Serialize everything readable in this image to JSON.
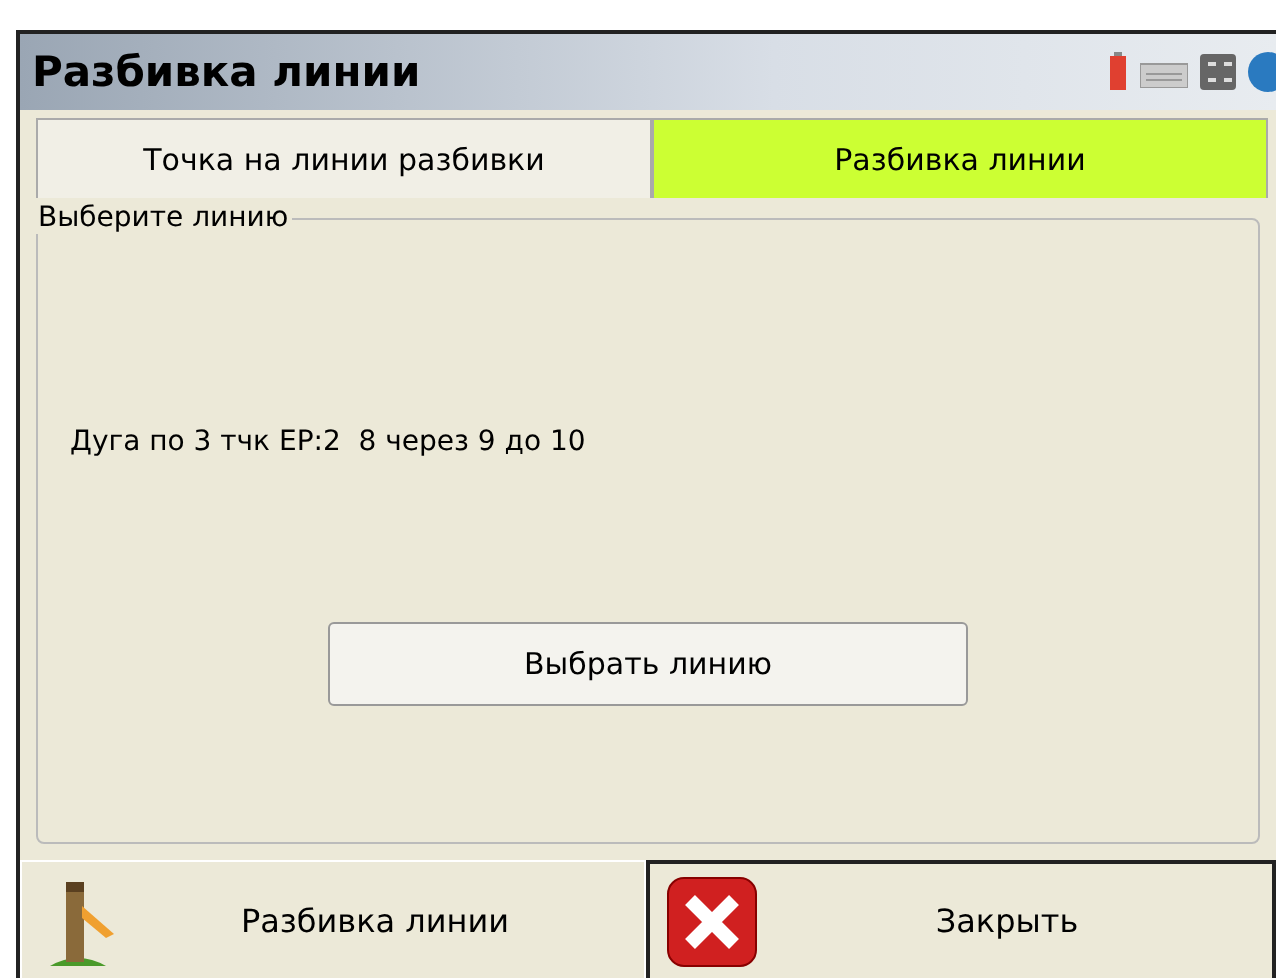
{
  "window": {
    "title": "Разбивка линии"
  },
  "tabs": [
    {
      "label": "Точка на линии разбивки",
      "selected": false
    },
    {
      "label": "Разбивка линии",
      "selected": true
    }
  ],
  "group": {
    "legend": "Выберите линию",
    "line": "Дуга по 3 тчк EP:2  8 через 9 до 10",
    "button": "Выбрать линию"
  },
  "footer_buttons": [
    {
      "kind": "stake",
      "label": "Разбивка линии",
      "focused": false
    },
    {
      "kind": "close",
      "label": "Закрыть",
      "focused": true
    }
  ]
}
